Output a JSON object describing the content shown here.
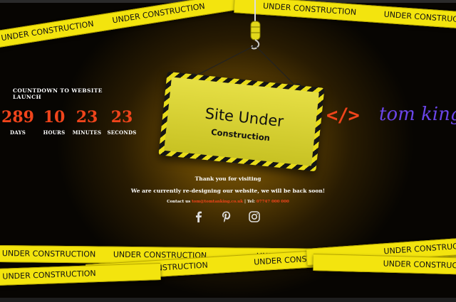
{
  "tape_label": "UNDER CONSTRUCTION",
  "countdown": {
    "title": "COUNTDOWN TO WEBSITE LAUNCH",
    "units": [
      {
        "value": "289",
        "label": "DAYS"
      },
      {
        "value": "10",
        "label": "HOURS"
      },
      {
        "value": "23",
        "label": "MINUTES"
      },
      {
        "value": "23",
        "label": "SECONDS"
      }
    ]
  },
  "sign": {
    "line1": "Site Under",
    "line2": "Construction"
  },
  "messages": {
    "thanks": "Thank you for visiting",
    "redesign": "We are currently re-designing our website, we will be back soon!",
    "contact_prefix": "Contact us",
    "email": "tom@tomtanking.co.uk",
    "tel_label": "| Tel:",
    "phone": "07747 000 000"
  },
  "brand": {
    "code_glyph": "</>",
    "name": "tom king"
  },
  "social": [
    {
      "icon": "facebook-icon"
    },
    {
      "icon": "pinterest-icon"
    },
    {
      "icon": "instagram-icon"
    }
  ],
  "colors": {
    "accent": "#f0441b",
    "tape": "#f3e40e",
    "brand": "#6a45e8"
  }
}
